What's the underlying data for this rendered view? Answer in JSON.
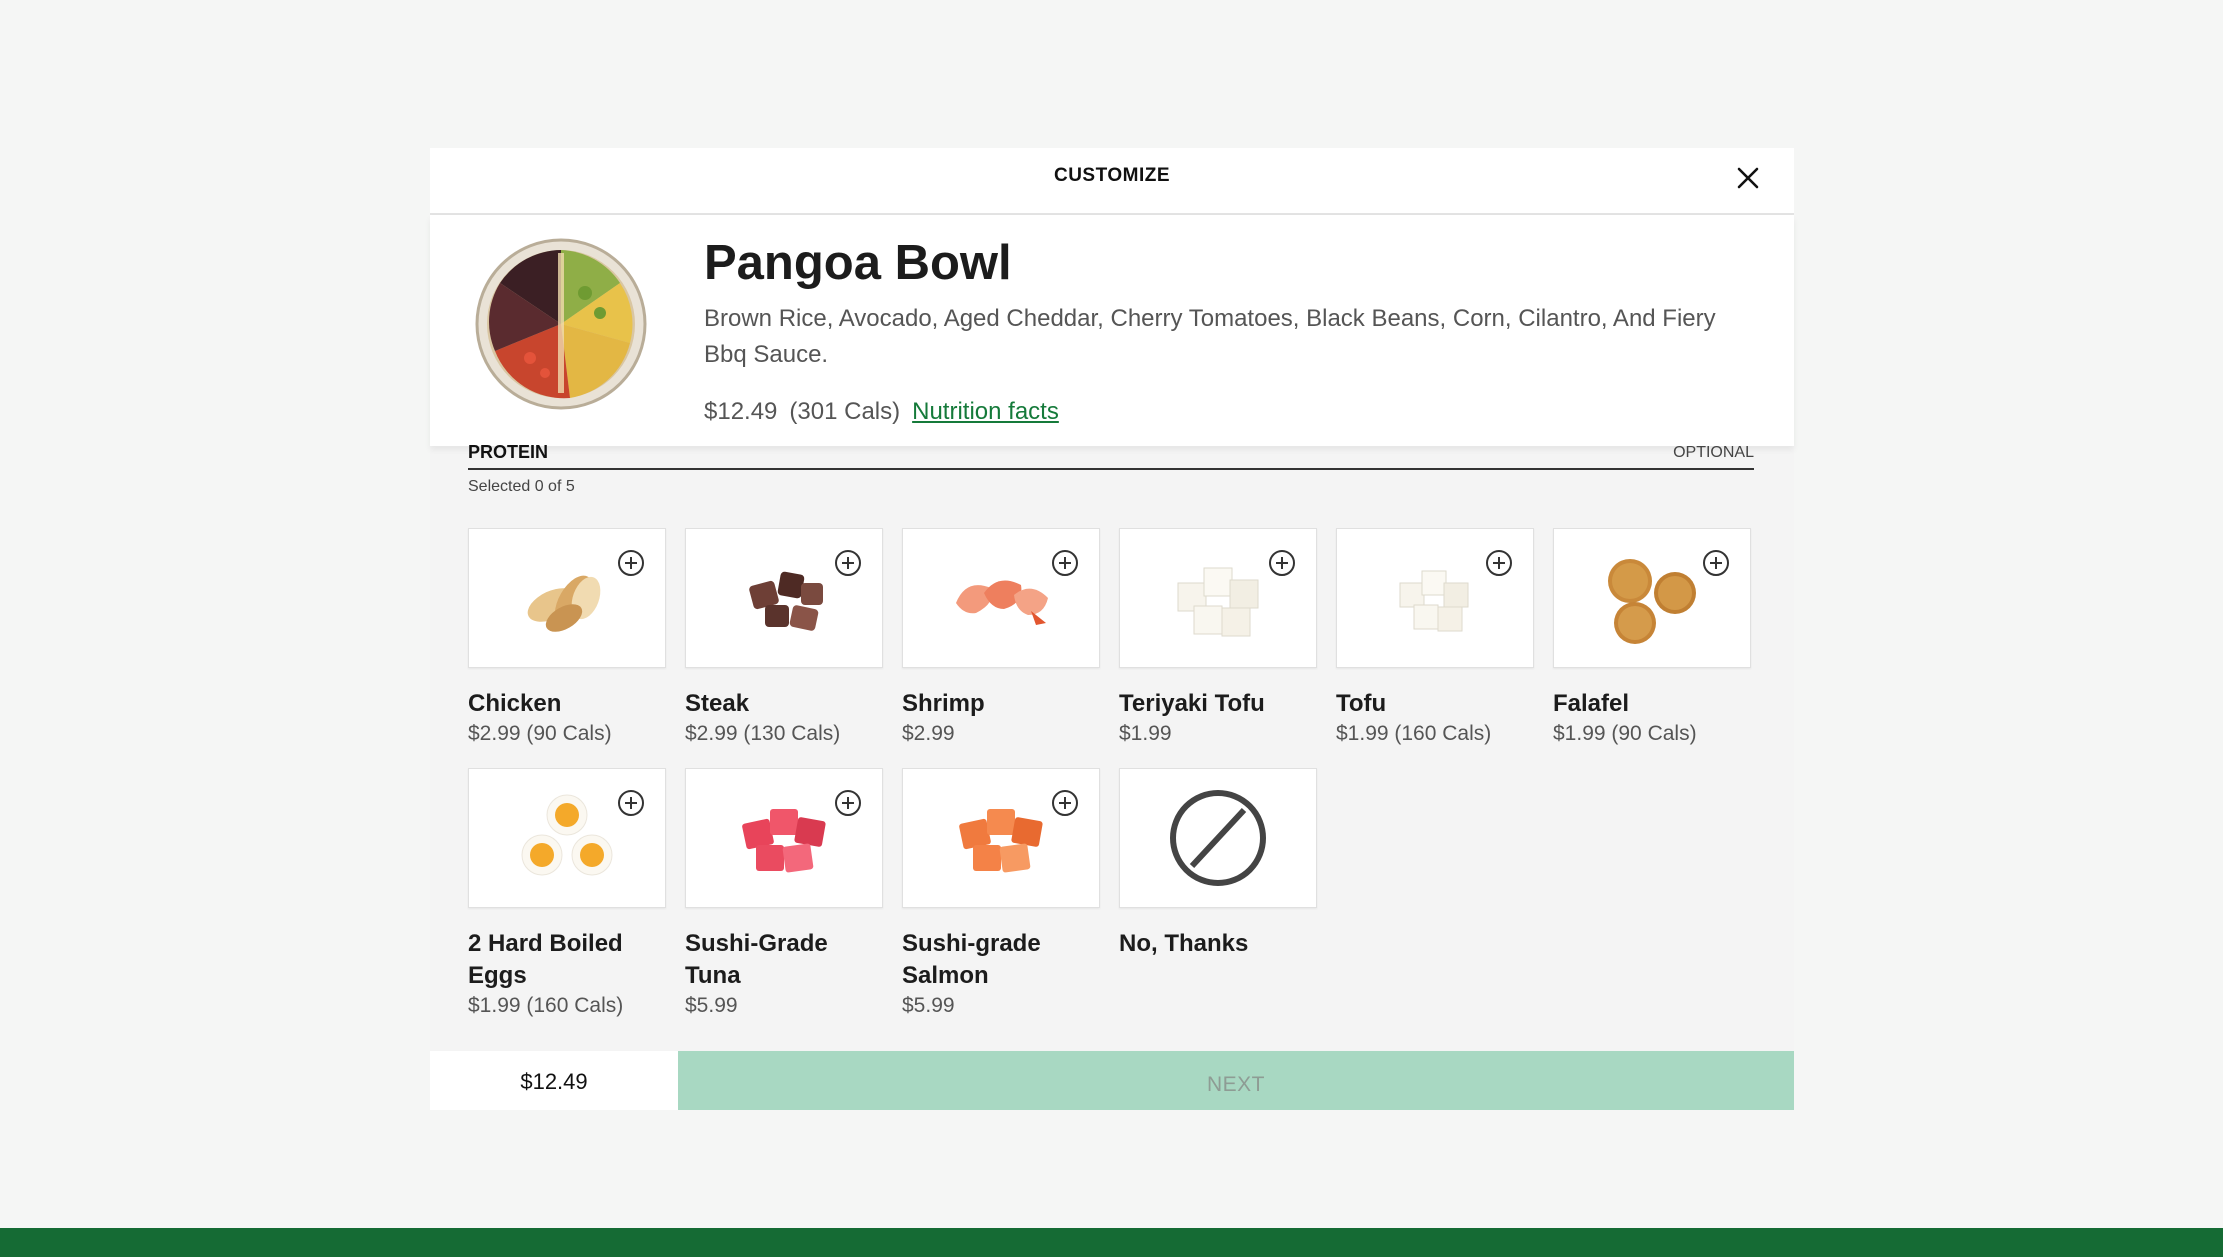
{
  "modal": {
    "title": "CUSTOMIZE",
    "close_icon": "close-icon"
  },
  "product": {
    "name": "Pangoa Bowl",
    "description": "Brown Rice, Avocado, Aged Cheddar, Cherry Tomatoes, Black Beans, Corn, Cilantro, And Fiery Bbq Sauce.",
    "price": "$12.49",
    "calories": "(301 Cals)",
    "nutrition_link": "Nutrition facts"
  },
  "section": {
    "title": "PROTEIN",
    "optional_label": "OPTIONAL",
    "selected_text": "Selected 0 of 5"
  },
  "options": [
    {
      "name": "Chicken",
      "price": "$2.99 (90 Cals)",
      "icon": "chicken-image"
    },
    {
      "name": "Steak",
      "price": "$2.99 (130 Cals)",
      "icon": "steak-image"
    },
    {
      "name": "Shrimp",
      "price": "$2.99",
      "icon": "shrimp-image"
    },
    {
      "name": "Teriyaki Tofu",
      "price": "$1.99",
      "icon": "tofu-image"
    },
    {
      "name": "Tofu",
      "price": "$1.99 (160 Cals)",
      "icon": "tofu-image"
    },
    {
      "name": "Falafel",
      "price": "$1.99 (90 Cals)",
      "icon": "falafel-image"
    },
    {
      "name": "2 Hard Boiled Eggs",
      "price": "$1.99 (160 Cals)",
      "icon": "eggs-image"
    },
    {
      "name": "Sushi-Grade Tuna",
      "price": "$5.99",
      "icon": "tuna-image"
    },
    {
      "name": "Sushi-grade Salmon",
      "price": "$5.99",
      "icon": "salmon-image"
    },
    {
      "name": "No, Thanks",
      "price": "",
      "icon": "no-symbol-icon"
    }
  ],
  "footer": {
    "total": "$12.49",
    "next_label": "NEXT"
  },
  "colors": {
    "brand_green": "#156b34",
    "next_button": "#a8d8c2",
    "link_green": "#157a3a"
  }
}
